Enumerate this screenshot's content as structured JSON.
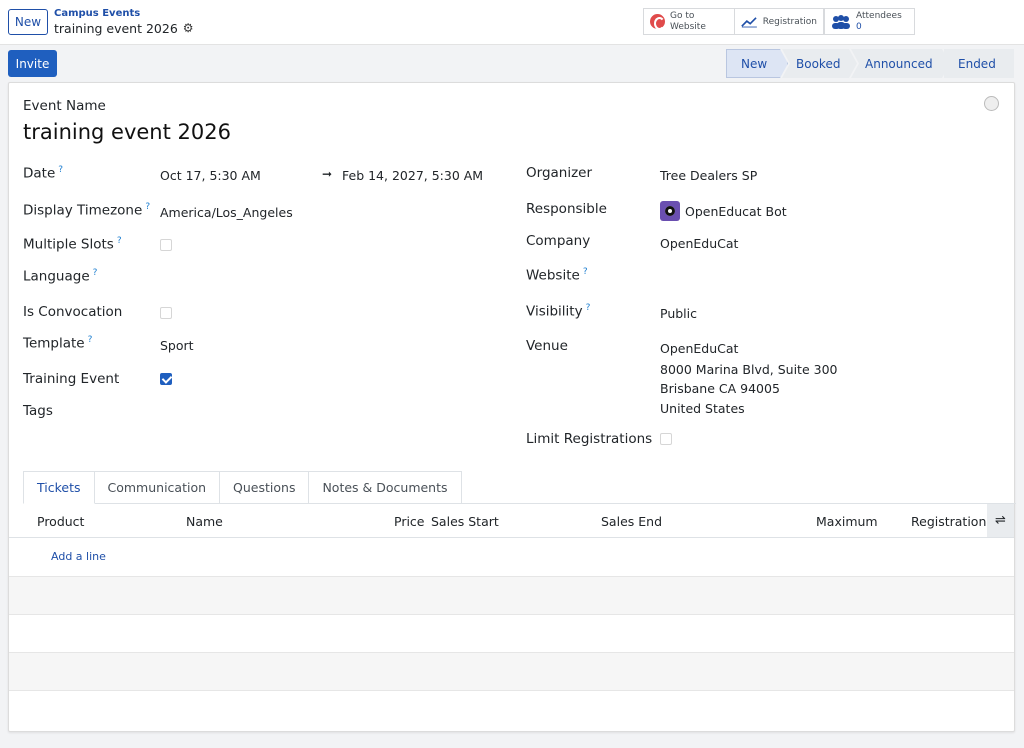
{
  "topbar": {
    "new_label": "New",
    "breadcrumb_parent": "Campus Events",
    "breadcrumb_current": "training event 2026",
    "smart_buttons": {
      "website_line1": "Go to",
      "website_line2": "Website",
      "registration": "Registration",
      "attendees_label": "Attendees",
      "attendees_count": "0"
    }
  },
  "controls": {
    "invite_label": "Invite",
    "stages": [
      "New",
      "Booked",
      "Announced",
      "Ended"
    ],
    "active_stage": "New"
  },
  "form": {
    "event_name_label": "Event Name",
    "event_name": "training event 2026",
    "left": {
      "date_label": "Date",
      "date_start": "Oct 17, 5:30 AM",
      "date_end": "Feb 14, 2027, 5:30 AM",
      "timezone_label": "Display Timezone",
      "timezone": "America/Los_Angeles",
      "multiple_slots_label": "Multiple Slots",
      "language_label": "Language",
      "convocation_label": "Is Convocation",
      "template_label": "Template",
      "template": "Sport",
      "training_label": "Training Event",
      "tags_label": "Tags"
    },
    "right": {
      "organizer_label": "Organizer",
      "organizer": "Tree Dealers SP",
      "responsible_label": "Responsible",
      "responsible": "OpenEducat Bot",
      "company_label": "Company",
      "company": "OpenEduCat",
      "website_label": "Website",
      "visibility_label": "Visibility",
      "visibility": "Public",
      "venue_label": "Venue",
      "venue_line1": "OpenEduCat",
      "venue_line2": "8000 Marina Blvd, Suite 300",
      "venue_line3": "Brisbane CA 94005",
      "venue_line4": "United States",
      "limit_label": "Limit Registrations"
    },
    "help_mark": "?"
  },
  "tabs": [
    "Tickets",
    "Communication",
    "Questions",
    "Notes & Documents"
  ],
  "table": {
    "columns": [
      "Product",
      "Name",
      "Price",
      "Sales Start",
      "Sales End",
      "Maximum",
      "Registration"
    ],
    "add_line": "Add a line"
  },
  "colors": {
    "primary": "#1f5fbf",
    "link": "#1f4fa8"
  },
  "icons": [
    "gear-icon",
    "globe-icon",
    "chart-line-icon",
    "users-icon",
    "arrow-right-icon",
    "column-settings-icon"
  ]
}
